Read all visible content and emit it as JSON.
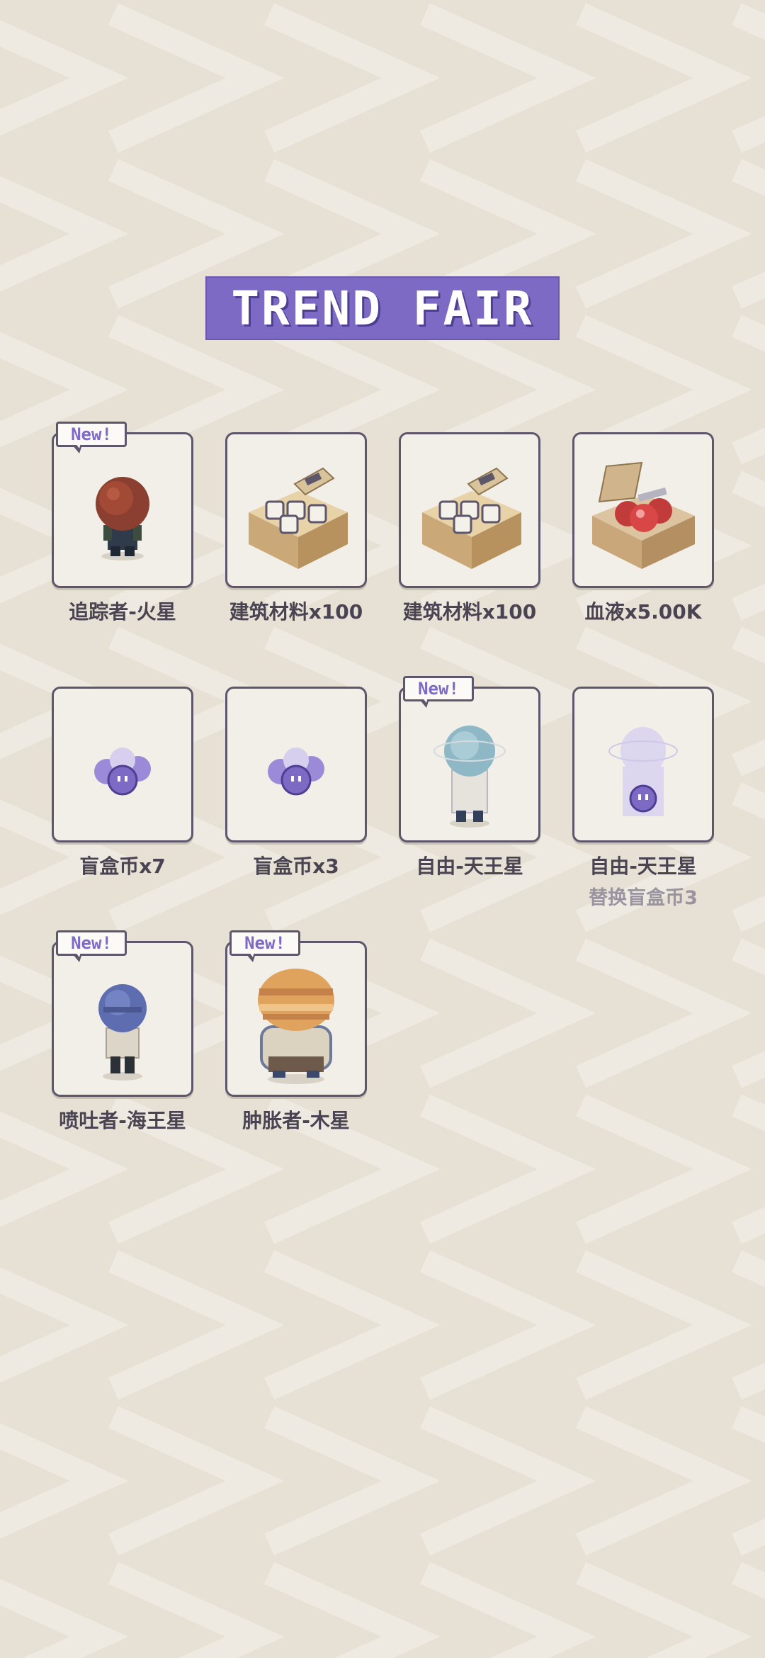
{
  "title": "TREND FAIR",
  "colors": {
    "background": "#e6e0d5",
    "chevron": "#eeeae1",
    "accent": "#7d6ac4",
    "border": "#5e566b",
    "label": "#4a4452",
    "sublabel": "#9a94a0"
  },
  "badge_text": "New!",
  "items": [
    {
      "label": "追踪者-火星",
      "sublabel": "",
      "is_new": true,
      "icon": "mars-tracker-character-icon"
    },
    {
      "label": "建筑材料x100",
      "sublabel": "",
      "is_new": false,
      "icon": "building-materials-box-icon"
    },
    {
      "label": "建筑材料x100",
      "sublabel": "",
      "is_new": false,
      "icon": "building-materials-box-icon"
    },
    {
      "label": "血液x5.00K",
      "sublabel": "",
      "is_new": false,
      "icon": "blood-crate-icon"
    },
    {
      "label": "盲盒币x7",
      "sublabel": "",
      "is_new": false,
      "icon": "blind-box-coin-icon"
    },
    {
      "label": "盲盒币x3",
      "sublabel": "",
      "is_new": false,
      "icon": "blind-box-coin-icon"
    },
    {
      "label": "自由-天王星",
      "sublabel": "",
      "is_new": true,
      "icon": "uranus-freedom-character-icon"
    },
    {
      "label": "自由-天王星",
      "sublabel": "替换盲盒币3",
      "is_new": false,
      "icon": "uranus-ghost-duplicate-icon"
    },
    {
      "label": "喷吐者-海王星",
      "sublabel": "",
      "is_new": true,
      "icon": "neptune-spitter-character-icon"
    },
    {
      "label": "肿胀者-木星",
      "sublabel": "",
      "is_new": true,
      "icon": "jupiter-bloater-character-icon"
    }
  ]
}
